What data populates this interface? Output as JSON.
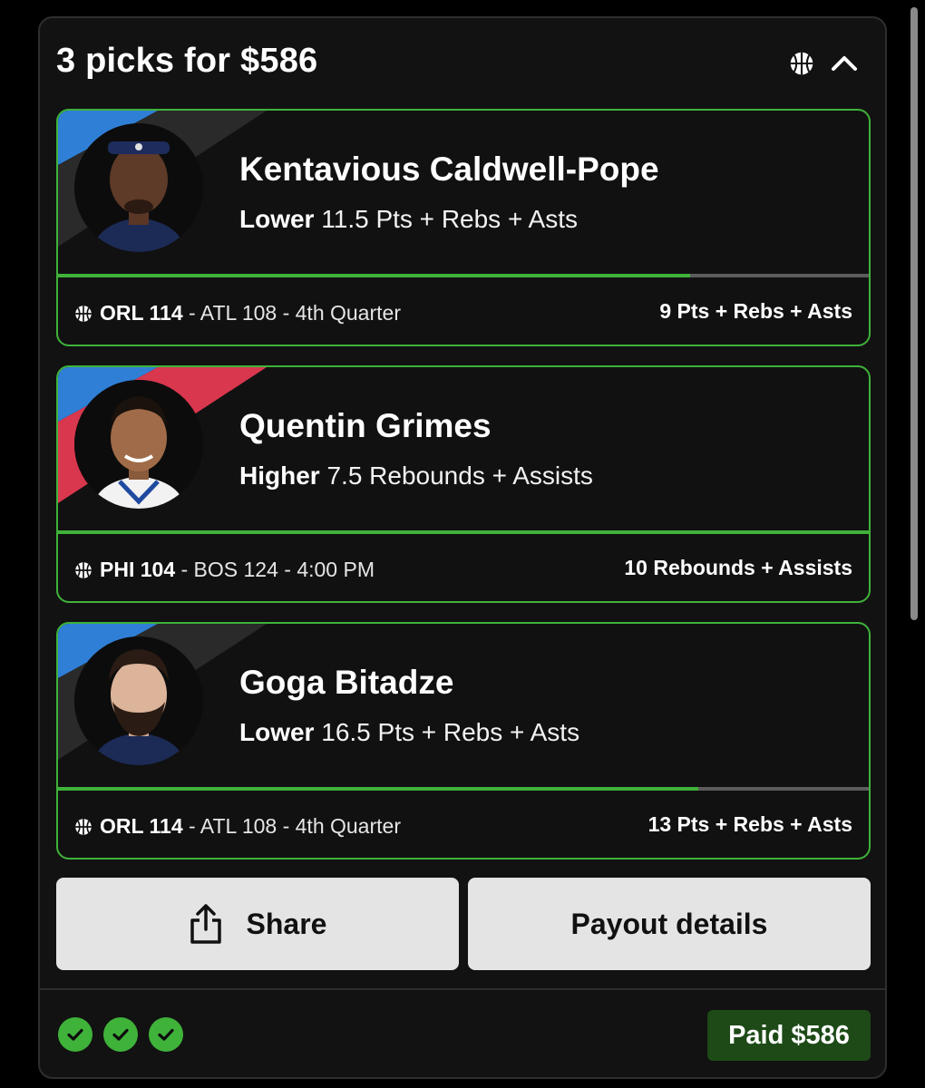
{
  "header": {
    "title": "3 picks for $586",
    "sport_icon": "basketball-icon",
    "collapse_icon": "chevron-up-icon"
  },
  "picks": [
    {
      "player": "Kentavious Caldwell-Pope",
      "direction": "Lower",
      "line": "11.5 Pts + Rebs + Asts",
      "team": "ORL 114",
      "game_rest": " - ATL 108 - 4th Quarter",
      "result": "9 Pts + Rebs + Asts",
      "progress": 0.78
    },
    {
      "player": "Quentin Grimes",
      "direction": "Higher",
      "line": "7.5 Rebounds + Assists",
      "team": "PHI 104",
      "game_rest": " - BOS 124 - 4:00 PM",
      "result": "10 Rebounds + Assists",
      "progress": 1.0
    },
    {
      "player": "Goga Bitadze",
      "direction": "Lower",
      "line": "16.5 Pts + Rebs + Asts",
      "team": "ORL 114",
      "game_rest": " - ATL 108 - 4th Quarter",
      "result": "13 Pts + Rebs + Asts",
      "progress": 0.79
    }
  ],
  "actions": {
    "share_label": "Share",
    "payout_label": "Payout details"
  },
  "footer": {
    "checks_count": 3,
    "paid_label": "Paid $586"
  },
  "colors": {
    "accent_green": "#3fb23a",
    "paid_bg": "#1d4a17",
    "card_bg": "#111111",
    "button_bg": "#e4e4e4"
  }
}
